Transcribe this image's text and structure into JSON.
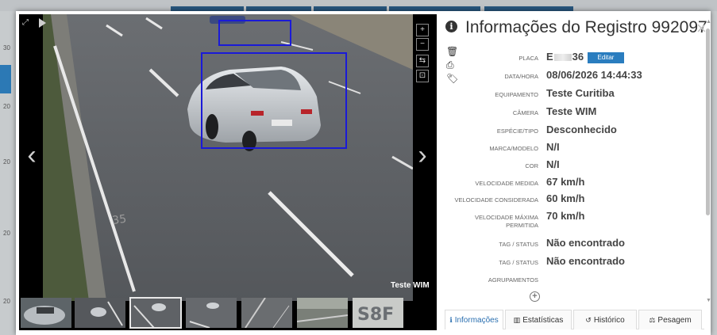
{
  "background": {
    "left_numbers": [
      "30",
      "20",
      "20",
      "20",
      "20"
    ]
  },
  "viewer": {
    "watermark": "Teste WIM",
    "thumbnails": [
      {
        "name": "thumb-1"
      },
      {
        "name": "thumb-2"
      },
      {
        "name": "thumb-3",
        "selected": true
      },
      {
        "name": "thumb-4"
      },
      {
        "name": "thumb-5"
      },
      {
        "name": "thumb-6"
      },
      {
        "name": "thumb-7"
      }
    ],
    "tools": [
      "+",
      "−",
      "⇆",
      "⊡"
    ]
  },
  "info": {
    "title": "Informações do Registro 992097",
    "close": "×",
    "edit_label": "Editar",
    "plate_prefix": "E",
    "plate_suffix": "36",
    "fields": [
      {
        "label": "PLACA",
        "value": ""
      },
      {
        "label": "DATA/HORA",
        "value": "08/06/2026 14:44:33"
      },
      {
        "label": "EQUIPAMENTO",
        "value": "Teste Curitiba"
      },
      {
        "label": "CÂMERA",
        "value": "Teste WIM"
      },
      {
        "label": "ESPÉCIE/TIPO",
        "value": "Desconhecido"
      },
      {
        "label": "MARCA/MODELO",
        "value": "N/I"
      },
      {
        "label": "COR",
        "value": "N/I"
      },
      {
        "label": "VELOCIDADE MEDIDA",
        "value": "67 km/h"
      },
      {
        "label": "VELOCIDADE CONSIDERADA",
        "value": "60 km/h"
      },
      {
        "label": "VELOCIDADE MÁXIMA PERMITIDA",
        "value": "70 km/h"
      },
      {
        "label": "TAG / STATUS",
        "value": "Não encontrado"
      },
      {
        "label": "TAG / STATUS",
        "value": "Não encontrado"
      },
      {
        "label": "AGRUPAMENTOS",
        "value": ""
      }
    ],
    "tabs": [
      {
        "label": "Informações",
        "icon": "ℹ",
        "active": true
      },
      {
        "label": "Estatísticas",
        "icon": "▥",
        "active": false
      },
      {
        "label": "Histórico",
        "icon": "↺",
        "active": false
      },
      {
        "label": "Pesagem",
        "icon": "⚖",
        "active": false
      }
    ]
  },
  "colors": {
    "accent": "#2a7dbf",
    "bounding_box": "#1a1ad8"
  }
}
